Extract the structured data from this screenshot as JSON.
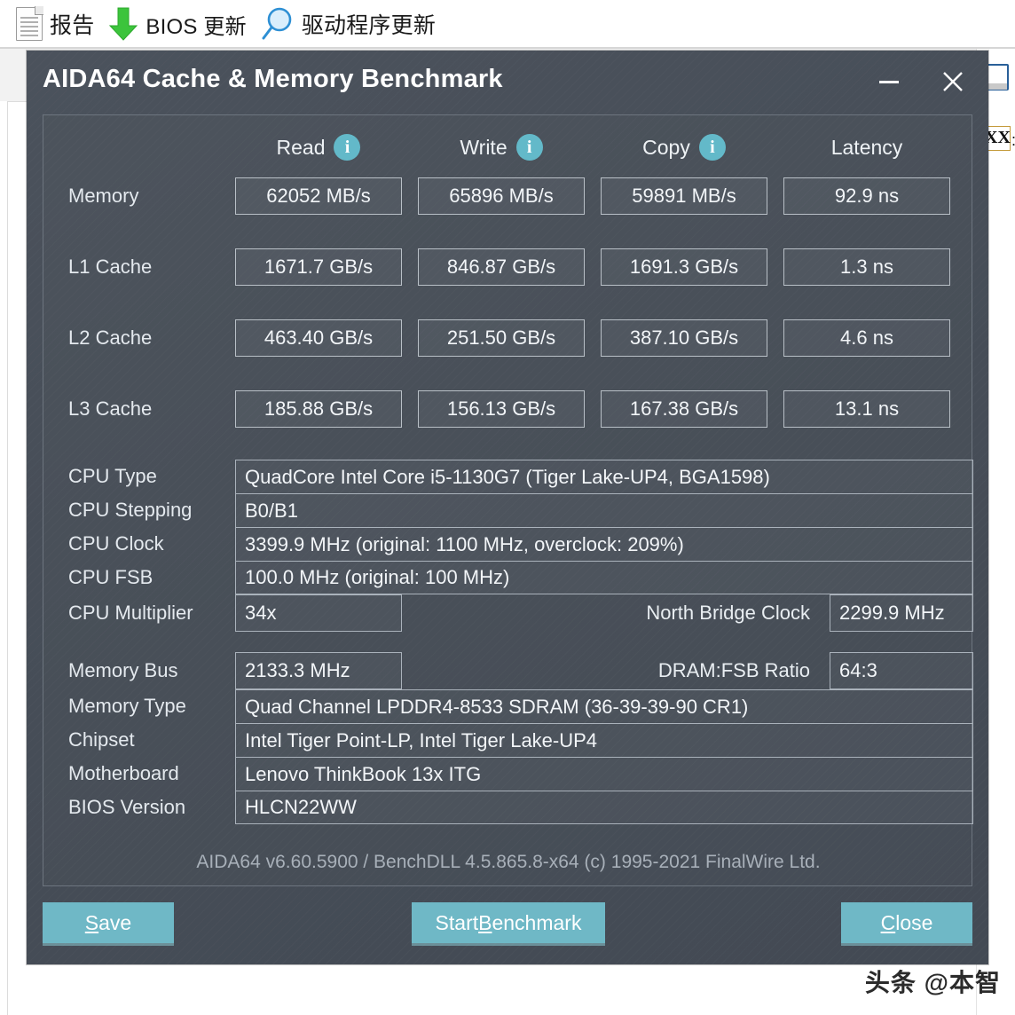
{
  "host_toolbar": {
    "items": [
      {
        "icon": "document-icon",
        "label": "报告"
      },
      {
        "icon": "green-down-arrow-icon",
        "label": "BIOS 更新"
      },
      {
        "icon": "magnifier-icon",
        "label": "驱动程序更新"
      }
    ]
  },
  "background": {
    "xx_box_label": "XX",
    "colon": ":"
  },
  "dialog": {
    "title": "AIDA64 Cache & Memory Benchmark",
    "minimize_tooltip": "—",
    "close_tooltip": "✕",
    "columns": [
      "Read",
      "Write",
      "Copy",
      "Latency"
    ],
    "info_icon_label": "i",
    "rows": [
      {
        "label": "Memory",
        "read": "62052 MB/s",
        "write": "65896 MB/s",
        "copy": "59891 MB/s",
        "latency": "92.9 ns"
      },
      {
        "label": "L1 Cache",
        "read": "1671.7 GB/s",
        "write": "846.87 GB/s",
        "copy": "1691.3 GB/s",
        "latency": "1.3 ns"
      },
      {
        "label": "L2 Cache",
        "read": "463.40 GB/s",
        "write": "251.50 GB/s",
        "copy": "387.10 GB/s",
        "latency": "4.6 ns"
      },
      {
        "label": "L3 Cache",
        "read": "185.88 GB/s",
        "write": "156.13 GB/s",
        "copy": "167.38 GB/s",
        "latency": "13.1 ns"
      }
    ],
    "cpu_info": [
      {
        "label": "CPU Type",
        "value": "QuadCore Intel Core i5-1130G7  (Tiger Lake-UP4, BGA1598)"
      },
      {
        "label": "CPU Stepping",
        "value": "B0/B1"
      },
      {
        "label": "CPU Clock",
        "value": "3399.9 MHz  (original: 1100 MHz, overclock: 209%)"
      },
      {
        "label": "CPU FSB",
        "value": "100.0 MHz  (original: 100 MHz)"
      }
    ],
    "cpu_multiplier": {
      "label": "CPU Multiplier",
      "value": "34x",
      "mid_label": "North Bridge Clock",
      "mid_value": "2299.9 MHz"
    },
    "memory_bus": {
      "label": "Memory Bus",
      "value": "2133.3 MHz",
      "mid_label": "DRAM:FSB Ratio",
      "mid_value": "64:3"
    },
    "mem_info": [
      {
        "label": "Memory Type",
        "value": "Quad Channel LPDDR4-8533 SDRAM  (36-39-39-90 CR1)"
      },
      {
        "label": "Chipset",
        "value": "Intel Tiger Point-LP, Intel Tiger Lake-UP4"
      },
      {
        "label": "Motherboard",
        "value": "Lenovo ThinkBook 13x ITG"
      },
      {
        "label": "BIOS Version",
        "value": "HLCN22WW"
      }
    ],
    "footer": "AIDA64 v6.60.5900 / BenchDLL 4.5.865.8-x64  (c) 1995-2021 FinalWire Ltd.",
    "buttons": {
      "save": {
        "pre": "",
        "acc": "S",
        "post": "ave"
      },
      "start": {
        "pre": "Start ",
        "acc": "B",
        "post": "enchmark"
      },
      "close": {
        "pre": "",
        "acc": "C",
        "post": "lose"
      }
    }
  },
  "watermark": "头条 @本智",
  "colors": {
    "dialog_bg": "#474e58",
    "accent_button": "#6fb8c6",
    "info_icon": "#63b9c9",
    "cell_border": "#b9c0c7",
    "arrow_green": "#3cc43c",
    "magnifier_blue": "#2d8fd4"
  }
}
